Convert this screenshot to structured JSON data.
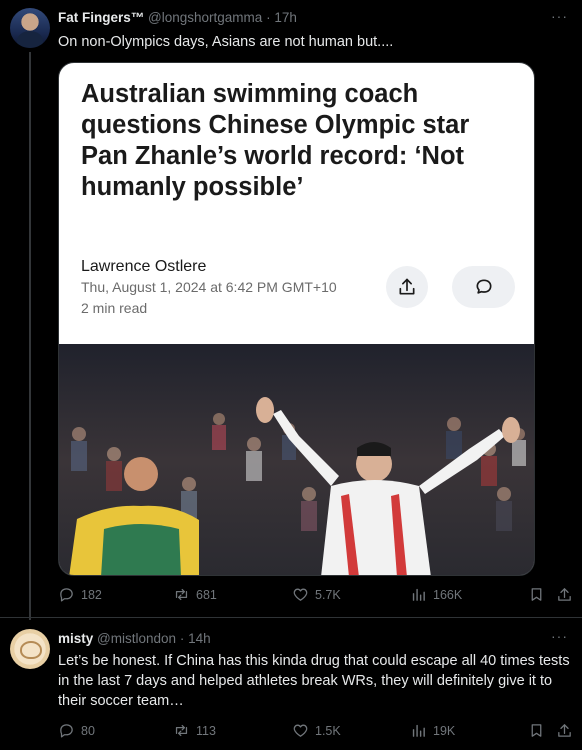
{
  "post1": {
    "display_name": "Fat Fingers™",
    "handle": "@longshortgamma",
    "dot": "·",
    "time": "17h",
    "text": "On non-Olympics days, Asians are not human but....",
    "more_label": "···",
    "card": {
      "headline": "Australian swimming coach questions Chinese Olympic star Pan Zhanle’s world record: ‘Not humanly possible’",
      "author": "Lawrence Ostlere",
      "date": "Thu, August 1, 2024 at 6:42 PM GMT+10",
      "read_time": "2 min read"
    },
    "metrics": {
      "replies": "182",
      "reposts": "681",
      "likes": "5.7K",
      "views": "166K"
    }
  },
  "post2": {
    "display_name": "misty",
    "handle": "@mistlondon",
    "dot": "·",
    "time": "14h",
    "text": "Let’s be honest. If China has this kinda drug that could escape all 40 times tests in the last 7 days and helped athletes break WRs, they will definitely give it to their soccer team…",
    "more_label": "···",
    "metrics": {
      "replies": "80",
      "reposts": "113",
      "likes": "1.5K",
      "views": "19K"
    }
  },
  "colors": {
    "background": "#000000",
    "text_primary": "#e7e9ea",
    "text_secondary": "#71767b",
    "border": "#2f3336",
    "card_background": "#ffffff"
  },
  "icons": [
    "reply-icon",
    "repost-icon",
    "like-icon",
    "views-icon",
    "bookmark-icon",
    "share-icon",
    "upload-share-icon",
    "comment-bubble-icon",
    "more-icon"
  ]
}
